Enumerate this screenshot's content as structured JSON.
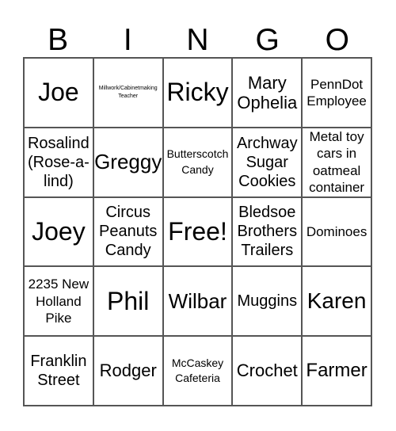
{
  "header": {
    "letters": [
      "B",
      "I",
      "N",
      "G",
      "O"
    ]
  },
  "cells": [
    [
      "Joe",
      "Millwork/Cabinetmaking Teacher",
      "Ricky",
      "Mary Ophelia",
      "PennDot Employee"
    ],
    [
      "Rosalind (Rose-a-lind)",
      "Greggy",
      "Butterscotch Candy",
      "Archway Sugar Cookies",
      "Metal toy cars in oatmeal container"
    ],
    [
      "Joey",
      "Circus Peanuts Candy",
      "Free!",
      "Bledsoe Brothers Trailers",
      "Dominoes"
    ],
    [
      "2235 New Holland Pike",
      "Phil",
      "Wilbar",
      "Muggins",
      "Karen"
    ],
    [
      "Franklin Street",
      "Rodger",
      "McCaskey Cafeteria",
      "Crochet",
      "Farmer"
    ]
  ],
  "colors": {
    "border": "#555555",
    "text": "#000000",
    "background": "#ffffff"
  }
}
